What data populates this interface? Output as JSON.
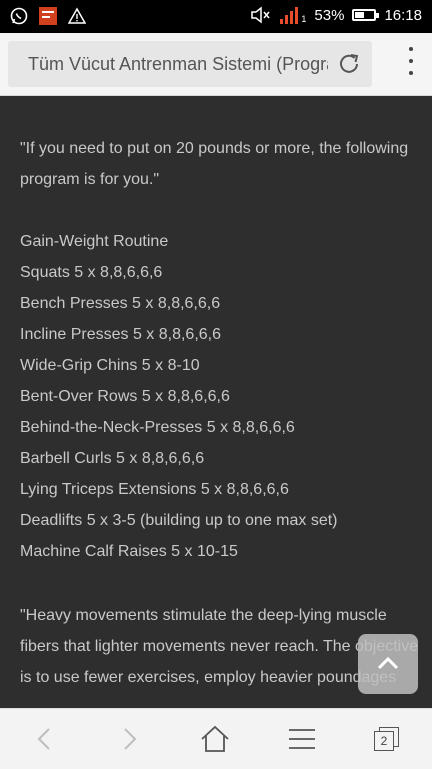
{
  "status_bar": {
    "battery": "53%",
    "time": "16:18",
    "sim_label": "1",
    "icons": [
      "whatsapp-icon",
      "app-notification-icon",
      "warning-icon",
      "mute-icon",
      "signal-icon",
      "battery-icon"
    ]
  },
  "browser": {
    "page_title": "Tüm Vücut Antrenman Sistemi (Progra",
    "tab_count": "2"
  },
  "article": {
    "intro_line1": "\"If you need to put on 20 pounds or more, the following",
    "intro_line2": "program is for you.\"",
    "routine_title": "Gain-Weight Routine",
    "exercises": [
      "Squats 5 x 8,8,6,6,6",
      "Bench Presses 5 x 8,8,6,6,6",
      "Incline Presses 5 x 8,8,6,6,6",
      "Wide-Grip Chins 5 x 8-10",
      "Bent-Over Rows 5 x 8,8,6,6,6",
      "Behind-the-Neck-Presses 5 x 8,8,6,6,6",
      "Barbell Curls 5 x 8,8,6,6,6",
      "Lying Triceps Extensions 5 x 8,8,6,6,6",
      "Deadlifts 5 x 3-5 (building up to one max set)",
      "Machine Calf Raises 5 x 10-15"
    ],
    "quote_line1": "\"Heavy movements stimulate the deep-lying muscle",
    "quote_line2": "fibers that lighter movements never reach. The objective",
    "quote_line3": "is to use fewer exercises, employ heavier poundages"
  }
}
